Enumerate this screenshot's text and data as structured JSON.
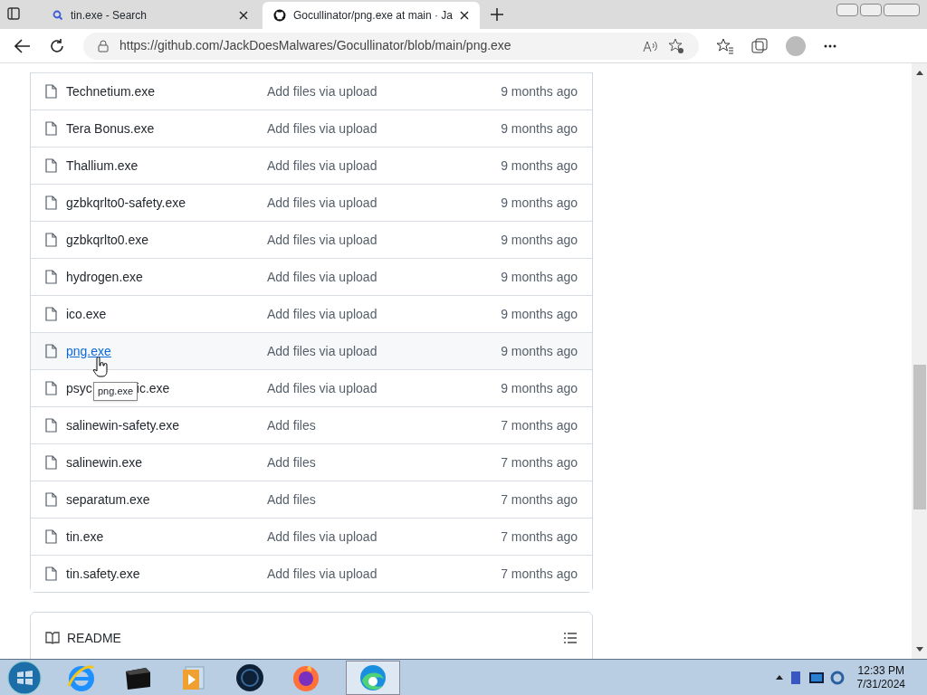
{
  "browser": {
    "tabs": [
      {
        "title": "tin.exe - Search",
        "kind": "search",
        "selected": false
      },
      {
        "title": "Gocullinator/png.exe at main · Ja",
        "kind": "github",
        "selected": true
      }
    ],
    "url": "https://github.com/JackDoesMalwares/Gocullinator/blob/main/png.exe"
  },
  "files": [
    {
      "name": "Technetium.exe",
      "message": "Add files via upload",
      "age": "9 months ago",
      "hovered": false
    },
    {
      "name": "Tera Bonus.exe",
      "message": "Add files via upload",
      "age": "9 months ago",
      "hovered": false
    },
    {
      "name": "Thallium.exe",
      "message": "Add files via upload",
      "age": "9 months ago",
      "hovered": false
    },
    {
      "name": "gzbkqrlto0-safety.exe",
      "message": "Add files via upload",
      "age": "9 months ago",
      "hovered": false
    },
    {
      "name": "gzbkqrlto0.exe",
      "message": "Add files via upload",
      "age": "9 months ago",
      "hovered": false
    },
    {
      "name": "hydrogen.exe",
      "message": "Add files via upload",
      "age": "9 months ago",
      "hovered": false
    },
    {
      "name": "ico.exe",
      "message": "Add files via upload",
      "age": "9 months ago",
      "hovered": false
    },
    {
      "name": "png.exe",
      "message": "Add files via upload",
      "age": "9 months ago",
      "hovered": true,
      "tooltip": "png.exe"
    },
    {
      "name": "psyc",
      "name_after": "ic.exe",
      "message": "Add files via upload",
      "age": "9 months ago",
      "hovered": false
    },
    {
      "name": "salinewin-safety.exe",
      "message": "Add files",
      "age": "7 months ago",
      "hovered": false
    },
    {
      "name": "salinewin.exe",
      "message": "Add files",
      "age": "7 months ago",
      "hovered": false
    },
    {
      "name": "separatum.exe",
      "message": "Add files",
      "age": "7 months ago",
      "hovered": false
    },
    {
      "name": "tin.exe",
      "message": "Add files via upload",
      "age": "7 months ago",
      "hovered": false
    },
    {
      "name": "tin.safety.exe",
      "message": "Add files via upload",
      "age": "7 months ago",
      "hovered": false
    }
  ],
  "readme": {
    "title": "README"
  },
  "taskbar": {
    "apps": [
      {
        "kind": "ie",
        "selected": false
      },
      {
        "kind": "box",
        "selected": false
      },
      {
        "kind": "media",
        "selected": false
      },
      {
        "kind": "globe",
        "selected": false
      },
      {
        "kind": "firefox",
        "selected": false
      },
      {
        "kind": "edge",
        "selected": true
      }
    ],
    "time": "12:33 PM",
    "date": "7/31/2024"
  }
}
